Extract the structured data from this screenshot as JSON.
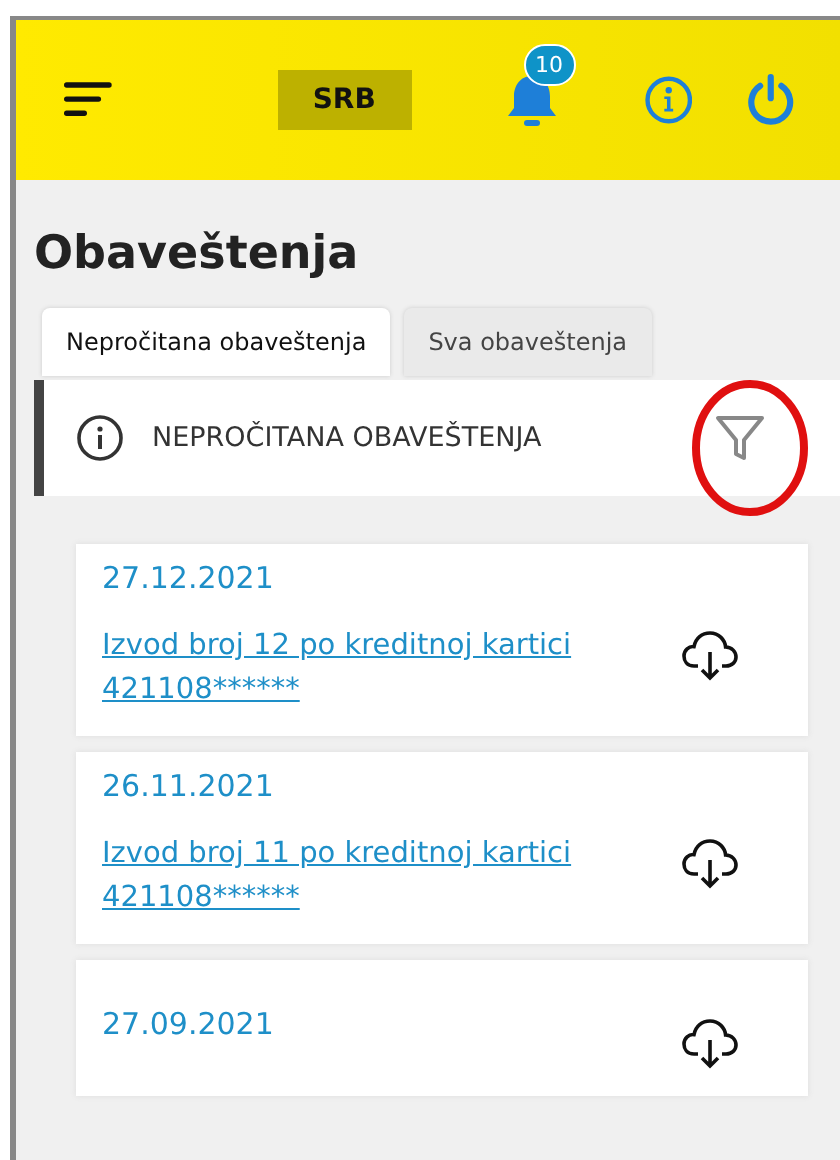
{
  "header": {
    "language": "SRB",
    "notification_count": "10"
  },
  "title": "Obaveštenja",
  "tabs": [
    {
      "label": "Nepročitana obaveštenja",
      "selected": true
    },
    {
      "label": "Sva obaveštenja",
      "selected": false
    }
  ],
  "section": {
    "title": "NEPROČITANA OBAVEŠTENJA",
    "filter_highlighted": true
  },
  "notifications": [
    {
      "date": "27.12.2021",
      "link": "Izvod broj 12 po kreditnoj kartici 421108******"
    },
    {
      "date": "26.11.2021",
      "link": "Izvod broj 11 po kreditnoj kartici 421108******"
    },
    {
      "date": "27.09.2021"
    }
  ]
}
